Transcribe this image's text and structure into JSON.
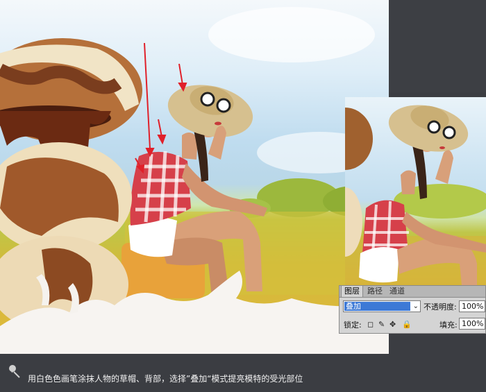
{
  "colors": {
    "background": "#3b3d42",
    "accent_arrow": "#e0202a",
    "selection": "#3d79d6"
  },
  "layers_panel": {
    "tabs": [
      "图层",
      "路径",
      "通道"
    ],
    "blend_mode": "叠加",
    "opacity_label": "不透明度:",
    "opacity_value": "100%",
    "lock_label": "锁定:",
    "fill_label": "填充:",
    "fill_value": "100%"
  },
  "caption": {
    "icon": "pushpin-icon",
    "text": "用白色色画笔涂抹人物的草帽、背部，选择”叠加“模式提亮模特的受光部位"
  }
}
